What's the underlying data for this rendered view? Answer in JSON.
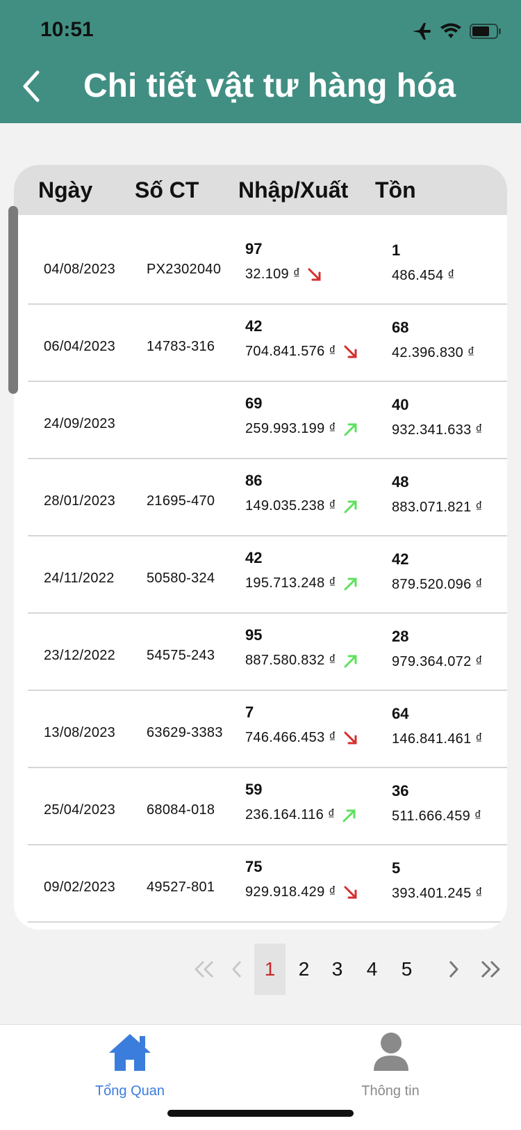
{
  "status_bar": {
    "time": "10:51"
  },
  "header": {
    "title": "Chi tiết vật tư hàng hóa"
  },
  "table": {
    "columns": [
      "Ngày",
      "Số CT",
      "Nhập/Xuất",
      "Tồn"
    ],
    "rows": [
      {
        "date": "04/08/2023",
        "doc": "PX2302040",
        "qty": "97",
        "amount": "32.109 ₫",
        "direction": "down",
        "stock_qty": "1",
        "stock_amount": "486.454 ₫"
      },
      {
        "date": "06/04/2023",
        "doc": "14783-316",
        "qty": "42",
        "amount": "704.841.576 ₫",
        "direction": "down",
        "stock_qty": "68",
        "stock_amount": "42.396.830 ₫"
      },
      {
        "date": "24/09/2023",
        "doc": "",
        "qty": "69",
        "amount": "259.993.199 ₫",
        "direction": "up",
        "stock_qty": "40",
        "stock_amount": "932.341.633 ₫"
      },
      {
        "date": "28/01/2023",
        "doc": "21695-470",
        "qty": "86",
        "amount": "149.035.238 ₫",
        "direction": "up",
        "stock_qty": "48",
        "stock_amount": "883.071.821 ₫"
      },
      {
        "date": "24/11/2022",
        "doc": "50580-324",
        "qty": "42",
        "amount": "195.713.248 ₫",
        "direction": "up",
        "stock_qty": "42",
        "stock_amount": "879.520.096 ₫"
      },
      {
        "date": "23/12/2022",
        "doc": "54575-243",
        "qty": "95",
        "amount": "887.580.832 ₫",
        "direction": "up",
        "stock_qty": "28",
        "stock_amount": "979.364.072 ₫"
      },
      {
        "date": "13/08/2023",
        "doc": "63629-3383",
        "qty": "7",
        "amount": "746.466.453 ₫",
        "direction": "down",
        "stock_qty": "64",
        "stock_amount": "146.841.461 ₫"
      },
      {
        "date": "25/04/2023",
        "doc": "68084-018",
        "qty": "59",
        "amount": "236.164.116 ₫",
        "direction": "up",
        "stock_qty": "36",
        "stock_amount": "511.666.459 ₫"
      },
      {
        "date": "09/02/2023",
        "doc": "49527-801",
        "qty": "75",
        "amount": "929.918.429 ₫",
        "direction": "down",
        "stock_qty": "5",
        "stock_amount": "393.401.245 ₫"
      }
    ]
  },
  "pagination": {
    "pages": [
      "1",
      "2",
      "3",
      "4",
      "5"
    ],
    "current": "1"
  },
  "bottom_nav": {
    "items": [
      {
        "label": "Tổng Quan",
        "icon": "home-icon",
        "active": true
      },
      {
        "label": "Thông tin",
        "icon": "person-icon",
        "active": false
      }
    ]
  },
  "colors": {
    "header": "#418f82",
    "active_nav": "#3b7ddd",
    "inactive_nav": "#8a8a8a",
    "arrow_down": "#d32f2f",
    "arrow_up": "#5fe05f",
    "current_page": "#c62828"
  }
}
